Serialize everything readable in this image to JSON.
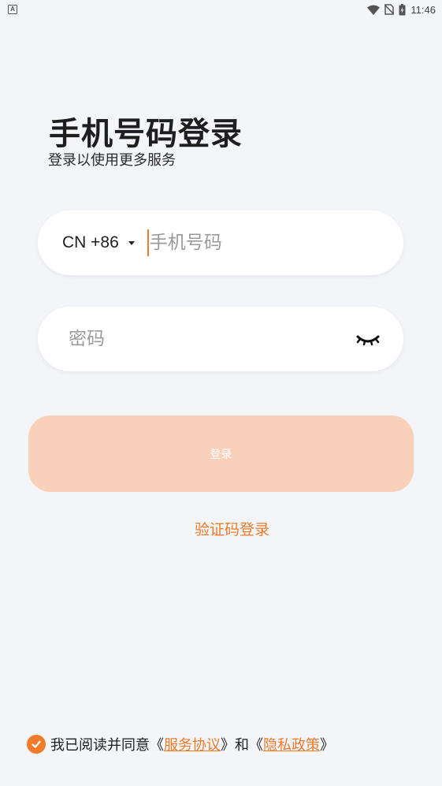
{
  "status_bar": {
    "app_badge": "A",
    "time": "11:46",
    "icons": [
      "wifi-icon",
      "no-sim-icon",
      "battery-charging-icon"
    ]
  },
  "header": {
    "title": "手机号码登录",
    "subtitle": "登录以使用更多服务"
  },
  "form": {
    "country_code": "CN +86",
    "phone_placeholder": "手机号码",
    "password_placeholder": "密码",
    "password_toggle_icon": "eye-closed-icon"
  },
  "actions": {
    "login_label": "登录",
    "code_login_label": "验证码登录"
  },
  "agreement": {
    "prefix": "我已阅读并同意《",
    "service_link": "服务协议",
    "middle": "》和《",
    "privacy_link": "隐私政策",
    "suffix": "》",
    "checked": true
  },
  "colors": {
    "accent": "#f07c2b",
    "login_button_disabled": "#f9d0b9",
    "background": "#f4f5f9"
  }
}
